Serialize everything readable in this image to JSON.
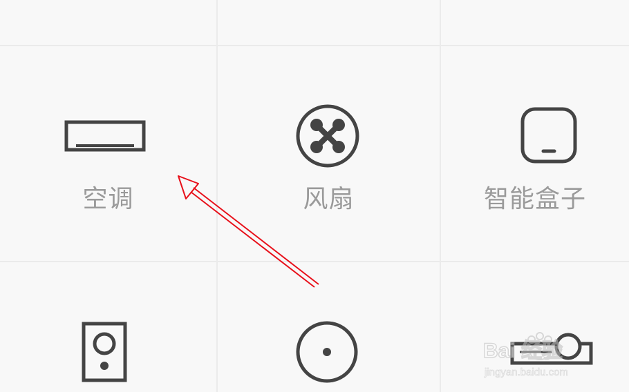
{
  "devices": [
    {
      "id": "ac",
      "label": "空调",
      "icon": "air-conditioner-icon"
    },
    {
      "id": "fan",
      "label": "风扇",
      "icon": "fan-icon"
    },
    {
      "id": "box",
      "label": "智能盒子",
      "icon": "tv-box-icon"
    },
    {
      "id": "speaker",
      "label": "",
      "icon": "speaker-icon"
    },
    {
      "id": "camera",
      "label": "",
      "icon": "camera-lens-icon"
    },
    {
      "id": "projector",
      "label": "",
      "icon": "projector-icon"
    }
  ],
  "watermark": {
    "brand": "Bai 经验",
    "url": "jingyan.baidu.com"
  },
  "colors": {
    "background": "#f8f8f8",
    "icon_stroke": "#444444",
    "label": "#9a9a9a",
    "divider": "#ebebeb",
    "annotation_arrow": "#e8101a"
  }
}
